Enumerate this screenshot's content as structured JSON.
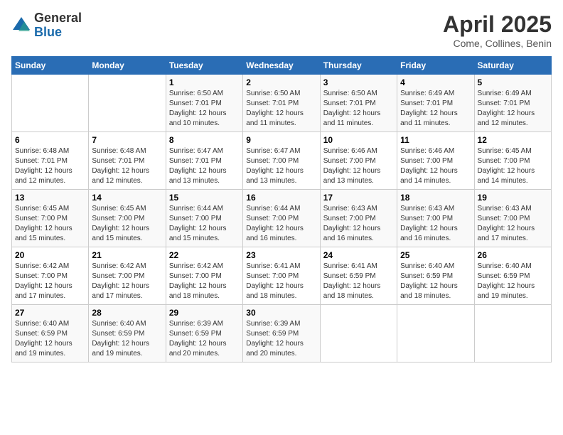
{
  "logo": {
    "general": "General",
    "blue": "Blue"
  },
  "title": "April 2025",
  "subtitle": "Come, Collines, Benin",
  "weekdays": [
    "Sunday",
    "Monday",
    "Tuesday",
    "Wednesday",
    "Thursday",
    "Friday",
    "Saturday"
  ],
  "weeks": [
    [
      {
        "day": "",
        "info": ""
      },
      {
        "day": "",
        "info": ""
      },
      {
        "day": "1",
        "info": "Sunrise: 6:50 AM\nSunset: 7:01 PM\nDaylight: 12 hours\nand 10 minutes."
      },
      {
        "day": "2",
        "info": "Sunrise: 6:50 AM\nSunset: 7:01 PM\nDaylight: 12 hours\nand 11 minutes."
      },
      {
        "day": "3",
        "info": "Sunrise: 6:50 AM\nSunset: 7:01 PM\nDaylight: 12 hours\nand 11 minutes."
      },
      {
        "day": "4",
        "info": "Sunrise: 6:49 AM\nSunset: 7:01 PM\nDaylight: 12 hours\nand 11 minutes."
      },
      {
        "day": "5",
        "info": "Sunrise: 6:49 AM\nSunset: 7:01 PM\nDaylight: 12 hours\nand 12 minutes."
      }
    ],
    [
      {
        "day": "6",
        "info": "Sunrise: 6:48 AM\nSunset: 7:01 PM\nDaylight: 12 hours\nand 12 minutes."
      },
      {
        "day": "7",
        "info": "Sunrise: 6:48 AM\nSunset: 7:01 PM\nDaylight: 12 hours\nand 12 minutes."
      },
      {
        "day": "8",
        "info": "Sunrise: 6:47 AM\nSunset: 7:01 PM\nDaylight: 12 hours\nand 13 minutes."
      },
      {
        "day": "9",
        "info": "Sunrise: 6:47 AM\nSunset: 7:00 PM\nDaylight: 12 hours\nand 13 minutes."
      },
      {
        "day": "10",
        "info": "Sunrise: 6:46 AM\nSunset: 7:00 PM\nDaylight: 12 hours\nand 13 minutes."
      },
      {
        "day": "11",
        "info": "Sunrise: 6:46 AM\nSunset: 7:00 PM\nDaylight: 12 hours\nand 14 minutes."
      },
      {
        "day": "12",
        "info": "Sunrise: 6:45 AM\nSunset: 7:00 PM\nDaylight: 12 hours\nand 14 minutes."
      }
    ],
    [
      {
        "day": "13",
        "info": "Sunrise: 6:45 AM\nSunset: 7:00 PM\nDaylight: 12 hours\nand 15 minutes."
      },
      {
        "day": "14",
        "info": "Sunrise: 6:45 AM\nSunset: 7:00 PM\nDaylight: 12 hours\nand 15 minutes."
      },
      {
        "day": "15",
        "info": "Sunrise: 6:44 AM\nSunset: 7:00 PM\nDaylight: 12 hours\nand 15 minutes."
      },
      {
        "day": "16",
        "info": "Sunrise: 6:44 AM\nSunset: 7:00 PM\nDaylight: 12 hours\nand 16 minutes."
      },
      {
        "day": "17",
        "info": "Sunrise: 6:43 AM\nSunset: 7:00 PM\nDaylight: 12 hours\nand 16 minutes."
      },
      {
        "day": "18",
        "info": "Sunrise: 6:43 AM\nSunset: 7:00 PM\nDaylight: 12 hours\nand 16 minutes."
      },
      {
        "day": "19",
        "info": "Sunrise: 6:43 AM\nSunset: 7:00 PM\nDaylight: 12 hours\nand 17 minutes."
      }
    ],
    [
      {
        "day": "20",
        "info": "Sunrise: 6:42 AM\nSunset: 7:00 PM\nDaylight: 12 hours\nand 17 minutes."
      },
      {
        "day": "21",
        "info": "Sunrise: 6:42 AM\nSunset: 7:00 PM\nDaylight: 12 hours\nand 17 minutes."
      },
      {
        "day": "22",
        "info": "Sunrise: 6:42 AM\nSunset: 7:00 PM\nDaylight: 12 hours\nand 18 minutes."
      },
      {
        "day": "23",
        "info": "Sunrise: 6:41 AM\nSunset: 7:00 PM\nDaylight: 12 hours\nand 18 minutes."
      },
      {
        "day": "24",
        "info": "Sunrise: 6:41 AM\nSunset: 6:59 PM\nDaylight: 12 hours\nand 18 minutes."
      },
      {
        "day": "25",
        "info": "Sunrise: 6:40 AM\nSunset: 6:59 PM\nDaylight: 12 hours\nand 18 minutes."
      },
      {
        "day": "26",
        "info": "Sunrise: 6:40 AM\nSunset: 6:59 PM\nDaylight: 12 hours\nand 19 minutes."
      }
    ],
    [
      {
        "day": "27",
        "info": "Sunrise: 6:40 AM\nSunset: 6:59 PM\nDaylight: 12 hours\nand 19 minutes."
      },
      {
        "day": "28",
        "info": "Sunrise: 6:40 AM\nSunset: 6:59 PM\nDaylight: 12 hours\nand 19 minutes."
      },
      {
        "day": "29",
        "info": "Sunrise: 6:39 AM\nSunset: 6:59 PM\nDaylight: 12 hours\nand 20 minutes."
      },
      {
        "day": "30",
        "info": "Sunrise: 6:39 AM\nSunset: 6:59 PM\nDaylight: 12 hours\nand 20 minutes."
      },
      {
        "day": "",
        "info": ""
      },
      {
        "day": "",
        "info": ""
      },
      {
        "day": "",
        "info": ""
      }
    ]
  ]
}
